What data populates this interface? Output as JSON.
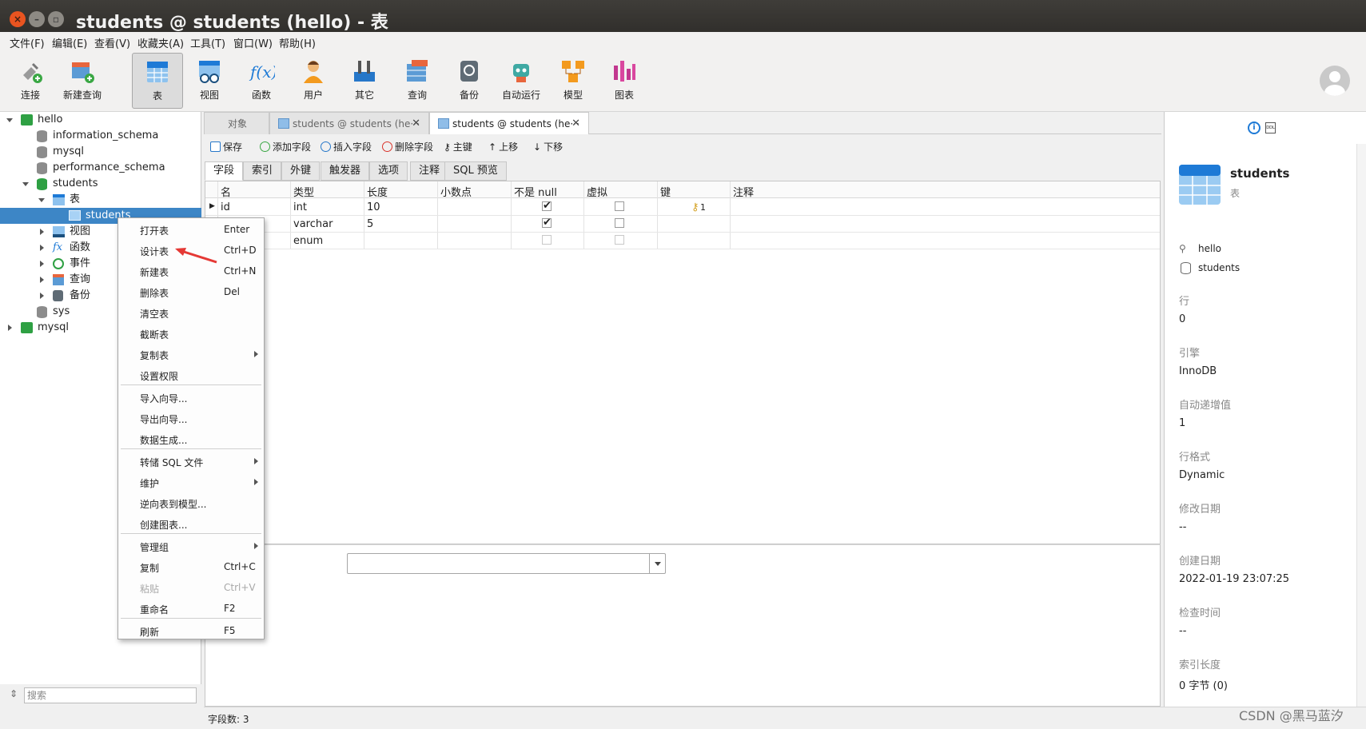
{
  "window": {
    "title": "students @ students (hello) - 表"
  },
  "menubar": [
    "文件(F)",
    "编辑(E)",
    "查看(V)",
    "收藏夹(A)",
    "工具(T)",
    "窗口(W)",
    "帮助(H)"
  ],
  "toolbar": {
    "connect": "连接",
    "new_query": "新建查询",
    "table": "表",
    "view": "视图",
    "function": "函数",
    "user": "用户",
    "other": "其它",
    "query": "查询",
    "backup": "备份",
    "autorun": "自动运行",
    "model": "模型",
    "chart": "图表"
  },
  "tree": {
    "hello": "hello",
    "information_schema": "information_schema",
    "mysql": "mysql",
    "performance_schema": "performance_schema",
    "students_db": "students",
    "tables": "表",
    "students_table": "students",
    "views": "视图",
    "functions": "函数",
    "events": "事件",
    "queries": "查询",
    "backups": "备份",
    "sys": "sys",
    "mysql_conn": "mysql"
  },
  "search": {
    "placeholder": "搜索"
  },
  "doc_tabs": {
    "objects": "对象",
    "tab1": "students @ students (he···",
    "tab2": "students @ students (he···"
  },
  "actions": {
    "save": "保存",
    "add_field": "添加字段",
    "insert_field": "插入字段",
    "delete_field": "删除字段",
    "primary_key": "主键",
    "move_up": "上移",
    "move_down": "下移"
  },
  "subtabs": {
    "fields": "字段",
    "indexes": "索引",
    "foreign_keys": "外键",
    "triggers": "触发器",
    "options": "选项",
    "comment": "注释",
    "sql_preview": "SQL 预览"
  },
  "grid": {
    "headers": {
      "name": "名",
      "type": "类型",
      "length": "长度",
      "decimals": "小数点",
      "not_null": "不是 null",
      "virtual": "虚拟",
      "key": "键",
      "comment": "注释"
    },
    "rows": [
      {
        "name": "id",
        "type": "int",
        "length": "10",
        "not_null": "✔",
        "key": "1"
      },
      {
        "name": "",
        "type": "varchar",
        "length": "5",
        "not_null": "✔",
        "key": ""
      },
      {
        "name": "",
        "type": "enum",
        "length": "",
        "not_null": "",
        "key": ""
      }
    ]
  },
  "status": {
    "field_count": "字段数: 3"
  },
  "right_panel": {
    "name": "students",
    "type": "表",
    "connection": "hello",
    "database": "students",
    "rows_label": "行",
    "rows_value": "0",
    "engine_label": "引擎",
    "engine_value": "InnoDB",
    "auto_inc_label": "自动递增值",
    "auto_inc_value": "1",
    "row_format_label": "行格式",
    "row_format_value": "Dynamic",
    "modified_label": "修改日期",
    "modified_value": "--",
    "created_label": "创建日期",
    "created_value": "2022-01-19 23:07:25",
    "check_label": "检查时间",
    "check_value": "--",
    "index_len_label": "索引长度",
    "index_len_value": "0 字节 (0)"
  },
  "context_menu": {
    "open": "打开表",
    "open_key": "Enter",
    "design": "设计表",
    "design_key": "Ctrl+D",
    "new": "新建表",
    "new_key": "Ctrl+N",
    "delete": "删除表",
    "delete_key": "Del",
    "empty": "清空表",
    "truncate": "截断表",
    "duplicate": "复制表",
    "permissions": "设置权限",
    "import": "导入向导...",
    "export": "导出向导...",
    "datagen": "数据生成...",
    "dump_sql": "转储 SQL 文件",
    "maintain": "维护",
    "reverse": "逆向表到模型...",
    "create_chart": "创建图表...",
    "manage_group": "管理组",
    "copy": "复制",
    "copy_key": "Ctrl+C",
    "paste": "粘贴",
    "paste_key": "Ctrl+V",
    "rename": "重命名",
    "rename_key": "F2",
    "refresh": "刷新",
    "refresh_key": "F5"
  },
  "watermark": "CSDN @黑马蓝汐"
}
